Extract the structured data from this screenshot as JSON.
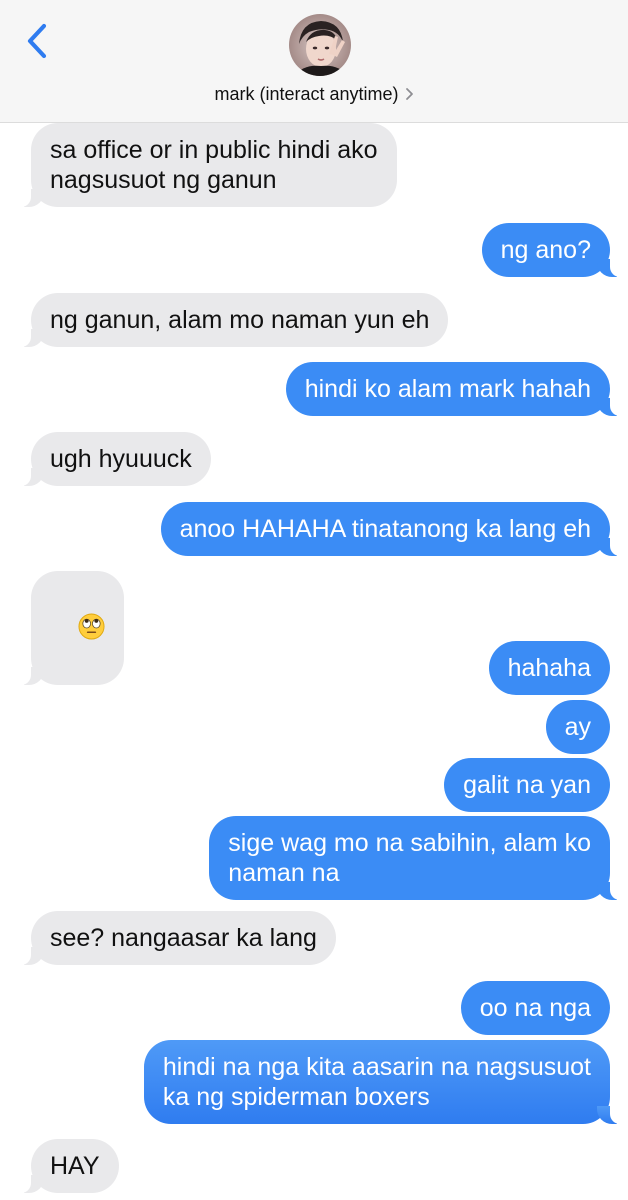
{
  "colors": {
    "header_bg": "#f6f6f6",
    "incoming_bubble": "#e9e9eb",
    "outgoing_bubble": "#3b8cf5",
    "accent": "#2f7cf0"
  },
  "header": {
    "back_icon": "chevron-left-icon",
    "contact_name": "mark (interact anytime)",
    "chevron_icon": "chevron-right-icon"
  },
  "messages": [
    {
      "from": "contact",
      "text": "sa office or in public hindi ako\nnagsusuot ng ganun"
    },
    {
      "from": "me",
      "text": "ng ano?"
    },
    {
      "from": "contact",
      "text": "ng ganun, alam mo naman yun eh"
    },
    {
      "from": "me",
      "text": "hindi ko alam mark hahah"
    },
    {
      "from": "contact",
      "text": "ugh hyuuuck"
    },
    {
      "from": "me",
      "text": "anoo HAHAHA tinatanong ka lang eh"
    },
    {
      "from": "contact",
      "emoji": "face-with-rolling-eyes"
    },
    {
      "from": "me",
      "text": "hahaha"
    },
    {
      "from": "me",
      "text": "ay"
    },
    {
      "from": "me",
      "text": "galit na yan"
    },
    {
      "from": "me",
      "text": "sige wag mo na sabihin, alam ko\nnaman na"
    },
    {
      "from": "contact",
      "text": "see? nangaasar ka lang"
    },
    {
      "from": "me",
      "text": "oo na nga"
    },
    {
      "from": "me",
      "text": "hindi na nga kita aasarin na nagsusuot\nka ng spiderman boxers"
    },
    {
      "from": "contact",
      "text": "HAY"
    }
  ]
}
